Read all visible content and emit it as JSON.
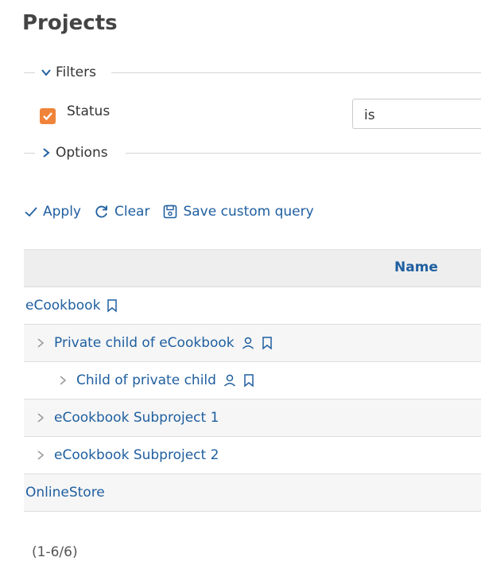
{
  "page": {
    "title": "Projects"
  },
  "filters": {
    "legend": "Filters",
    "status": {
      "label": "Status",
      "checked": true,
      "operator": "is"
    }
  },
  "options": {
    "legend": "Options"
  },
  "actions": {
    "apply": "Apply",
    "clear": "Clear",
    "save": "Save custom query"
  },
  "table": {
    "header_name": "Name",
    "rows": [
      {
        "name": "eCookbook"
      },
      {
        "name": "Private child of eCookbook"
      },
      {
        "name": "Child of private child"
      },
      {
        "name": "eCookbook Subproject 1"
      },
      {
        "name": "eCookbook Subproject 2"
      },
      {
        "name": "OnlineStore"
      }
    ]
  },
  "pagination": {
    "text": "(1-6/6)"
  },
  "colors": {
    "link": "#1f5fa0",
    "checkbox": "#f0833a",
    "header_bg": "#eeeeee",
    "alt_row": "#f6f6f6"
  }
}
